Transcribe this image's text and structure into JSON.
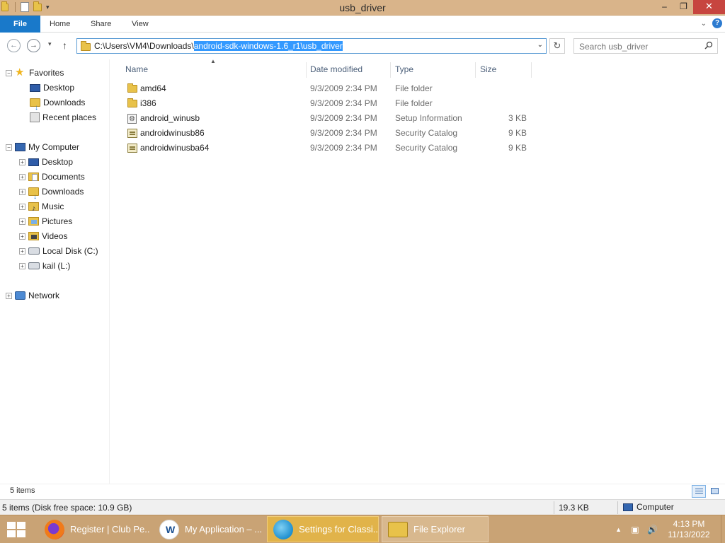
{
  "window": {
    "title": "usb_driver",
    "controls": {
      "minimize": "–",
      "maximize": "❐",
      "close": "✕"
    }
  },
  "ribbon": {
    "tabs": [
      "File",
      "Home",
      "Share",
      "View"
    ],
    "help": "?"
  },
  "address_bar": {
    "path_prefix": "C:\\Users\\VM4\\Downloads\\",
    "path_selected": "android-sdk-windows-1.6_r1\\usb_driver",
    "search_placeholder": "Search usb_driver"
  },
  "nav_pane": {
    "favorites": {
      "label": "Favorites",
      "items": [
        "Desktop",
        "Downloads",
        "Recent places"
      ]
    },
    "computer": {
      "label": "My Computer",
      "items": [
        "Desktop",
        "Documents",
        "Downloads",
        "Music",
        "Pictures",
        "Videos",
        "Local Disk (C:)",
        "kail (L:)"
      ]
    },
    "network": {
      "label": "Network"
    }
  },
  "file_list": {
    "columns": [
      "Name",
      "Date modified",
      "Type",
      "Size"
    ],
    "rows": [
      {
        "name": "amd64",
        "date": "9/3/2009 2:34 PM",
        "type": "File folder",
        "size": "",
        "icon": "folder-icon"
      },
      {
        "name": "i386",
        "date": "9/3/2009 2:34 PM",
        "type": "File folder",
        "size": "",
        "icon": "folder-icon"
      },
      {
        "name": "android_winusb",
        "date": "9/3/2009 2:34 PM",
        "type": "Setup Information",
        "size": "3 KB",
        "icon": "setup-file-icon"
      },
      {
        "name": "androidwinusb86",
        "date": "9/3/2009 2:34 PM",
        "type": "Security Catalog",
        "size": "9 KB",
        "icon": "catalog-file-icon"
      },
      {
        "name": "androidwinusba64",
        "date": "9/3/2009 2:34 PM",
        "type": "Security Catalog",
        "size": "9 KB",
        "icon": "catalog-file-icon"
      }
    ]
  },
  "status_bar": {
    "item_count": "5 items"
  },
  "details_bar": {
    "summary": "5 items (Disk free space: 10.9 GB)",
    "size": "19.3 KB",
    "location": "Computer"
  },
  "taskbar": {
    "items": [
      {
        "label": "Register | Club Pe...",
        "icon": "firefox-icon"
      },
      {
        "label": "My Application – ...",
        "icon": "webstorm-icon"
      },
      {
        "label": "Settings for Classi...",
        "icon": "globe-icon"
      },
      {
        "label": "File Explorer",
        "icon": "file-explorer-icon"
      }
    ],
    "time": "4:13 PM",
    "date": "11/13/2022"
  },
  "colors": {
    "title_bar": "#d9b48a",
    "file_tab": "#1979ca",
    "taskbar": "#c9a375",
    "selection": "#3399ff"
  }
}
